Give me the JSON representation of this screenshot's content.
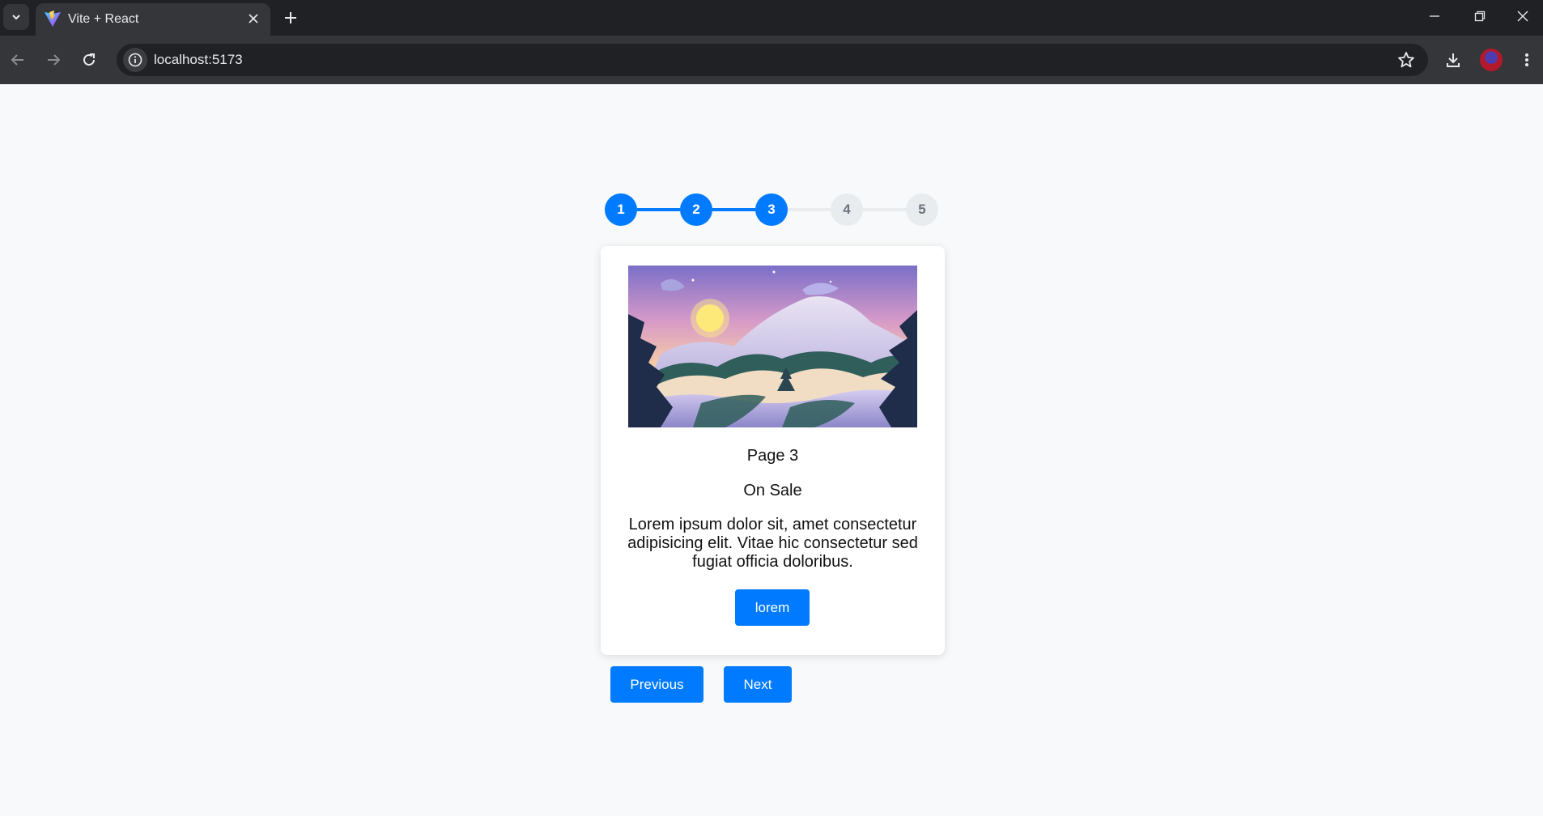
{
  "browser": {
    "tab_title": "Vite + React",
    "url": "localhost:5173"
  },
  "stepper": {
    "steps": [
      "1",
      "2",
      "3",
      "4",
      "5"
    ],
    "current_step": 3,
    "active_color": "#007bff",
    "inactive_color": "#e9ecef"
  },
  "card": {
    "image_icon": "snowy-mountain-sunset-illustration",
    "heading": "Page 3",
    "subheading": "On Sale",
    "description": "Lorem ipsum dolor sit, amet consectetur adipisicing elit. Vitae hic consectetur sed fugiat officia doloribus.",
    "button_label": "lorem"
  },
  "pagination": {
    "previous_label": "Previous",
    "next_label": "Next"
  },
  "colors": {
    "accent": "#007bff",
    "page_background": "#f8f9fa"
  }
}
